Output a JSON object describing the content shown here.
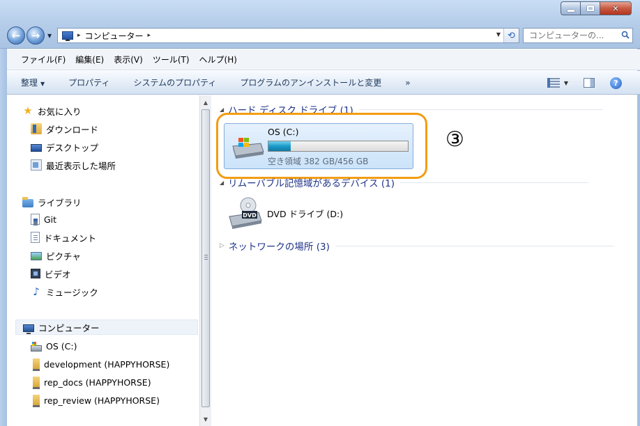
{
  "window": {
    "address": {
      "path_root": "コンピューター",
      "separator": "▸"
    },
    "search": {
      "placeholder": "コンピューターの..."
    }
  },
  "menu": {
    "items": [
      "ファイル(F)",
      "編集(E)",
      "表示(V)",
      "ツール(T)",
      "ヘルプ(H)"
    ]
  },
  "commandbar": {
    "organize": "整理",
    "properties": "プロパティ",
    "system_properties": "システムのプロパティ",
    "uninstall": "プログラムのアンインストールと変更",
    "more": "»"
  },
  "navigation": {
    "favorites": {
      "label": "お気に入り",
      "items": [
        "ダウンロード",
        "デスクトップ",
        "最近表示した場所"
      ]
    },
    "libraries": {
      "label": "ライブラリ",
      "items": [
        "Git",
        "ドキュメント",
        "ピクチャ",
        "ビデオ",
        "ミュージック"
      ]
    },
    "computer": {
      "label": "コンピューター",
      "items": [
        "OS (C:)",
        "development (HAPPYHORSE)",
        "rep_docs (HAPPYHORSE)",
        "rep_review (HAPPYHORSE)"
      ]
    }
  },
  "content": {
    "hdd_group": "ハード ディスク ドライブ (1)",
    "removable_group": "リムーバブル記憶域があるデバイス (1)",
    "network_group": "ネットワークの場所 (3)",
    "drive_c": {
      "name": "OS (C:)",
      "free_text": "空き領域 382 GB/456 GB",
      "used_fraction": 0.16
    },
    "dvd": {
      "name": "DVD ドライブ (D:)",
      "badge": "DVD"
    },
    "annotation": "③"
  },
  "colors": {
    "highlight": "#f39c12",
    "group_header": "#1e3287"
  }
}
